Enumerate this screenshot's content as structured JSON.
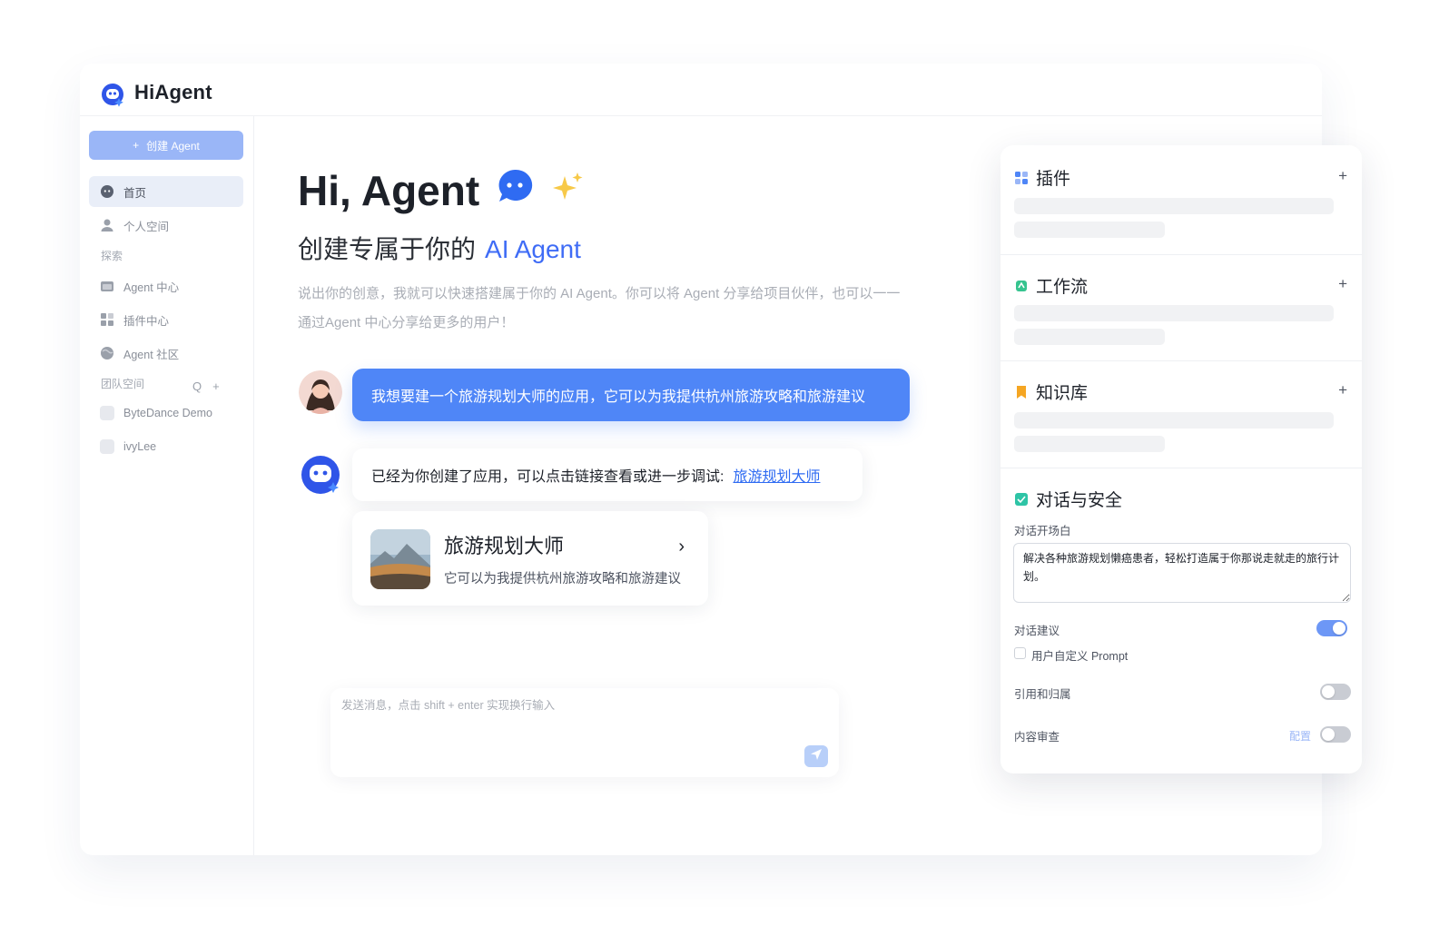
{
  "brand": {
    "name": "HiAgent"
  },
  "sidebar": {
    "create_button": "创建 Agent",
    "create_icon": "+",
    "items": [
      {
        "label": "首页",
        "icon": "chat-icon"
      },
      {
        "label": "个人空间",
        "icon": "user-icon"
      }
    ],
    "explore_label": "探索",
    "explore_items": [
      {
        "label": "Agent 中心",
        "icon": "folder-icon"
      },
      {
        "label": "插件中心",
        "icon": "plugin-grid-icon"
      },
      {
        "label": "Agent 社区",
        "icon": "globe-icon"
      }
    ],
    "team_label": "团队空间",
    "team_search_icon": "Q",
    "team_add_icon": "+",
    "teams": [
      {
        "label": "ByteDance Demo"
      },
      {
        "label": "ivyLee"
      }
    ]
  },
  "main": {
    "title": "Hi, Agent",
    "subtitle_prefix": "创建专属于你的",
    "subtitle_highlight": "AI Agent",
    "description": "说出你的创意，我就可以快速搭建属于你的 AI Agent。你可以将 Agent 分享给项目伙伴，也可以一一通过Agent 中心分享给更多的用户！",
    "user_message": "我想要建一个旅游规划大师的应用，它可以为我提供杭州旅游攻略和旅游建议",
    "bot_message": "已经为你创建了应用，可以点击链接查看或进一步调试:",
    "bot_link": "旅游规划大师",
    "app_card": {
      "name": "旅游规划大师",
      "description": "它可以为我提供杭州旅游攻略和旅游建议",
      "arrow": "›"
    },
    "composer_placeholder": "发送消息，点击 shift + enter 实现换行输入"
  },
  "panel": {
    "plus": "+",
    "plugins_title": "插件",
    "workflow_title": "工作流",
    "knowledge_title": "知识库",
    "safety_title": "对话与安全",
    "opener_label": "对话开场白",
    "opener_value": "解决各种旅游规划懒癌患者，轻松打造属于你那说走就走的旅行计划。",
    "suggestion_label": "对话建议",
    "suggestion_on": true,
    "custom_prompt_label": "用户自定义 Prompt",
    "citation_label": "引用和归属",
    "citation_on": false,
    "moderation_label": "内容审查",
    "moderation_config": "配置",
    "moderation_on": false
  },
  "colors": {
    "accent": "#3f6cf6",
    "bubble": "#4f86f7",
    "toggle_on": "#6d97f6"
  }
}
